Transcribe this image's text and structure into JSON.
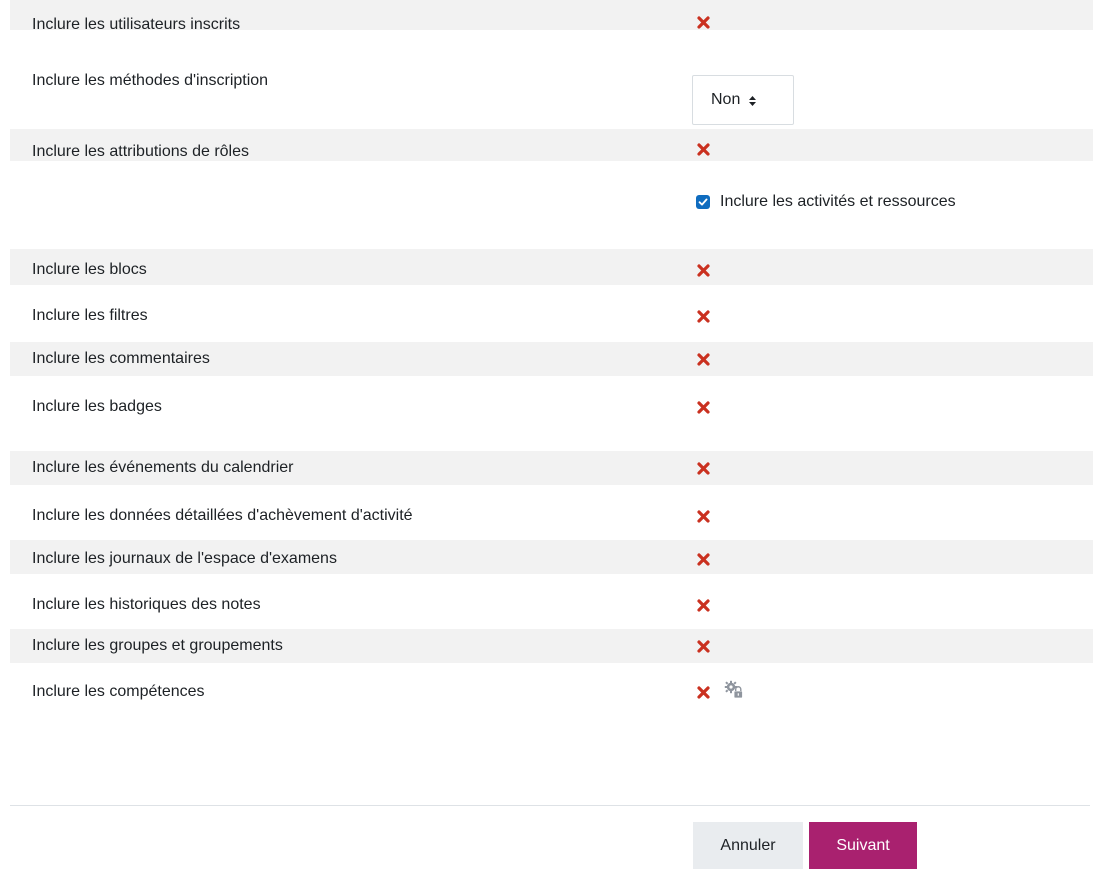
{
  "settings": [
    {
      "label": "Inclure les utilisateurs inscrits",
      "type": "cross"
    },
    {
      "label": "Inclure les méthodes d'inscription",
      "type": "select",
      "value": "Non"
    },
    {
      "label": "Inclure les attributions de rôles",
      "type": "cross"
    },
    {
      "label": "",
      "type": "checkbox",
      "checkbox_label": "Inclure les activités et ressources",
      "checked": true
    },
    {
      "label": "Inclure les blocs",
      "type": "cross"
    },
    {
      "label": "Inclure les filtres",
      "type": "cross"
    },
    {
      "label": "Inclure les commentaires",
      "type": "cross"
    },
    {
      "label": "Inclure les badges",
      "type": "cross"
    },
    {
      "label": "Inclure les événements du calendrier",
      "type": "cross"
    },
    {
      "label": "Inclure les données détaillées d'achèvement d'activité",
      "type": "cross"
    },
    {
      "label": "Inclure les journaux de l'espace d'examens",
      "type": "cross"
    },
    {
      "label": "Inclure les historiques des notes",
      "type": "cross"
    },
    {
      "label": "Inclure les groupes et groupements",
      "type": "cross"
    },
    {
      "label": "Inclure les compétences",
      "type": "cross-lock"
    }
  ],
  "buttons": {
    "cancel_label": "Annuler",
    "next_label": "Suivant"
  },
  "colors": {
    "shaded_row": "#f2f2f2",
    "cross": "#ca3120",
    "checkbox": "#0f6cbf",
    "primary": "#a9216f",
    "secondary": "#e9ecef",
    "lock_icon": "#8f959e"
  },
  "icons": {
    "cross": "cross-icon",
    "lock": "locked-setting-icon",
    "select_arrows": "sort-arrows-icon",
    "check": "checkmark-icon"
  }
}
